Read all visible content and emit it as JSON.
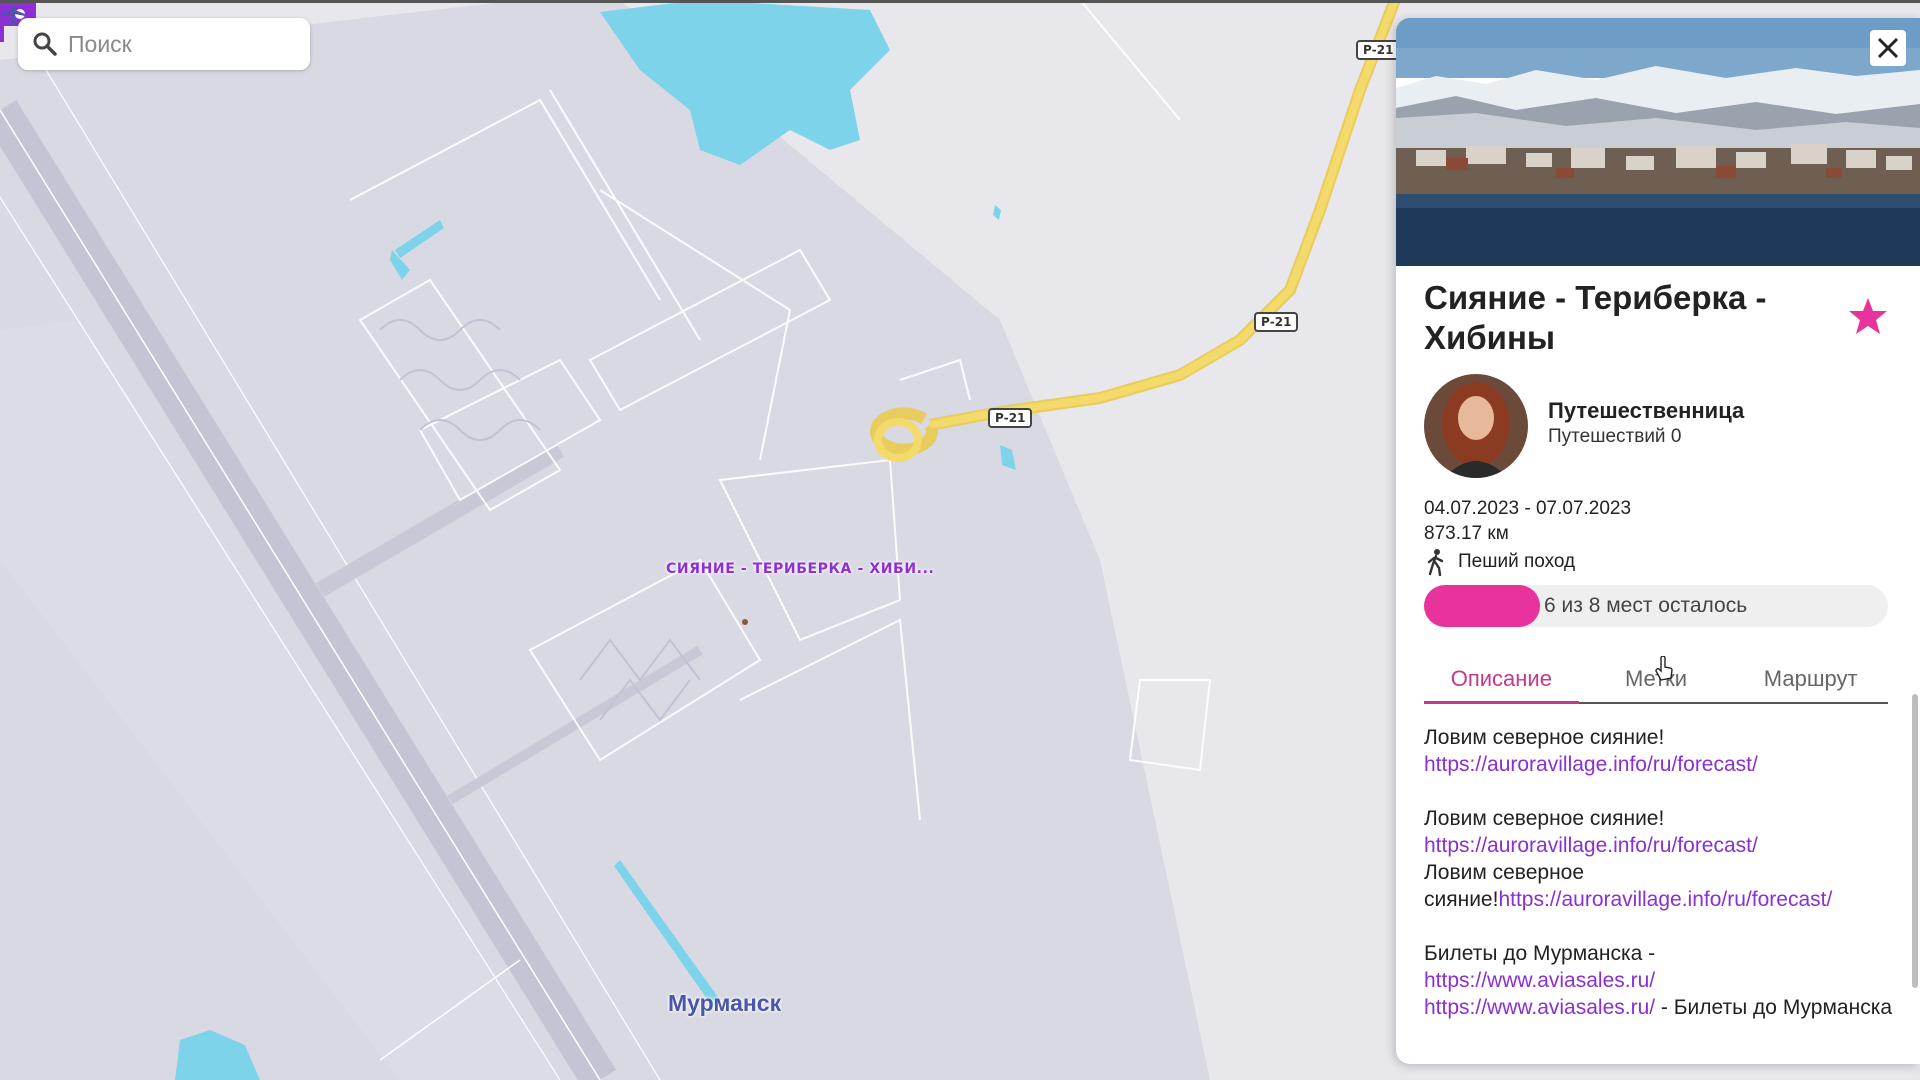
{
  "search": {
    "placeholder": "Поиск"
  },
  "map": {
    "road_label": "Р-21",
    "pin_label": "СИЯНИЕ - ТЕРИБЕРКА - ХИБИ...",
    "city_label": "Мурманск",
    "colors": {
      "land": "#e8e8ec",
      "airport_zone": "#d8d8e3",
      "water": "#7dd3ea",
      "road": "#f1d36a",
      "pin": "#8e2fd6"
    }
  },
  "panel": {
    "title": "Сияние - Териберка - Хибины",
    "author": {
      "name": "Путешественница",
      "trips": "Путешествий 0"
    },
    "dates": "04.07.2023 - 07.07.2023",
    "distance": "873.17 км",
    "trip_type": "Пеший поход",
    "seats": {
      "text": "6 из 8 мест осталось",
      "fill_fraction": 0.25
    },
    "tabs": [
      "Описание",
      "Метки",
      "Маршрут"
    ],
    "active_tab": "Описание",
    "description": {
      "line1": "Ловим северное сияние!",
      "link1": "https://auroravillage.info/ru/forecast/",
      "line2": "Ловим северное сияние!",
      "link2": "https://auroravillage.info/ru/forecast/",
      "line3a": "Ловим северное сияние!",
      "link3": "https://auroravillage.info/ru/forecast/",
      "line4": "Билеты до Мурманска -",
      "link4": "https://www.aviasales.ru/",
      "link5": "https://www.aviasales.ru/",
      "line5": " - Билеты до Мурманска"
    },
    "colors": {
      "accent": "#e8339c",
      "tab_active": "#c8388a",
      "link": "#8b2fd3"
    }
  }
}
